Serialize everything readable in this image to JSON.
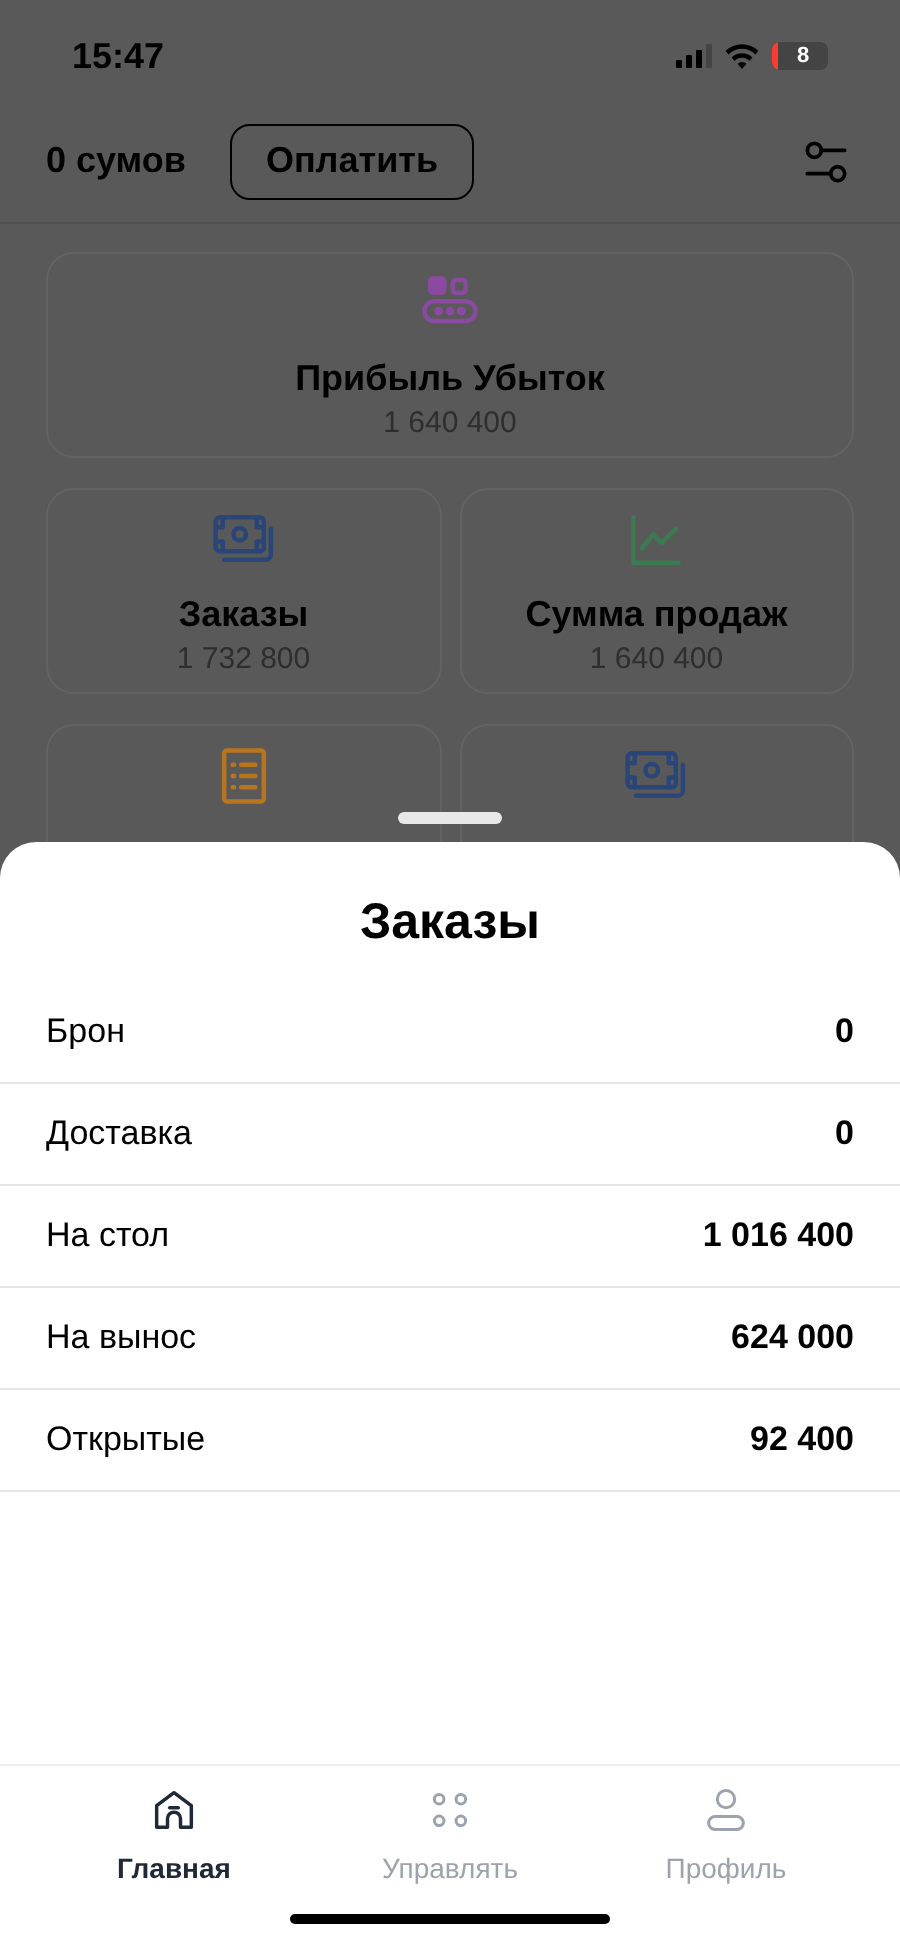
{
  "status_bar": {
    "time": "15:47",
    "battery": "8"
  },
  "header": {
    "balance": "0 сумов",
    "pay_button": "Оплатить"
  },
  "cards": [
    {
      "title": "Прибыль Убыток",
      "value": "1 640 400",
      "color": "#8a4aa0"
    },
    {
      "title": "Заказы",
      "value": "1 732 800",
      "color": "#2a4678"
    },
    {
      "title": "Сумма продаж",
      "value": "1 640 400",
      "color": "#3b7a52"
    },
    {
      "color": "#b9741e"
    },
    {
      "color": "#2a4678"
    }
  ],
  "sheet": {
    "title": "Заказы",
    "rows": [
      {
        "label": "Брон",
        "value": "0"
      },
      {
        "label": "Доставка",
        "value": "0"
      },
      {
        "label": "На стол",
        "value": "1 016 400"
      },
      {
        "label": "На вынос",
        "value": "624 000"
      },
      {
        "label": "Открытые",
        "value": "92 400"
      }
    ]
  },
  "tab_bar": [
    {
      "label": "Главная",
      "selected": true
    },
    {
      "label": "Управлять",
      "selected": false
    },
    {
      "label": "Профиль",
      "selected": false
    }
  ]
}
